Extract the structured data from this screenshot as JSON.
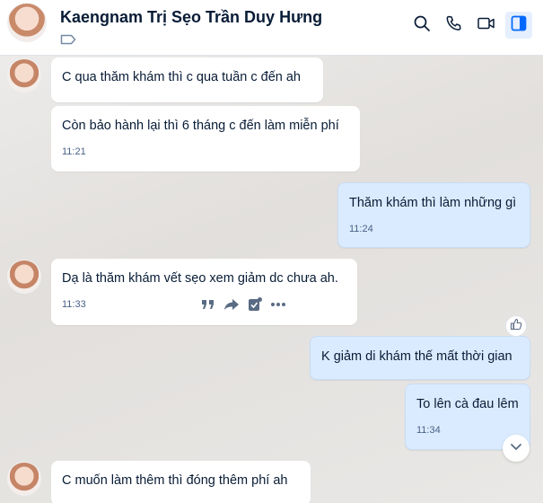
{
  "header": {
    "contact_name": "Kaengnam Trị Sẹo Trần Duy Hưng",
    "icons": [
      "search-icon",
      "phone-icon",
      "video-icon",
      "sidebar-toggle-icon"
    ],
    "tag_icon": "tag-icon",
    "accent": "#0068ff"
  },
  "messages": [
    {
      "direction": "in",
      "text": "C qua thăm khám thì c qua tuần c đến ah",
      "time": ""
    },
    {
      "direction": "in",
      "text": "Còn bảo hành lại thì 6 tháng c đến làm miễn phí",
      "time": "11:21"
    },
    {
      "direction": "out",
      "text": "Thăm khám thì làm những gì",
      "time": "11:24"
    },
    {
      "direction": "in",
      "text": "Dạ là thăm khám vết sẹo xem giảm dc chưa ah.",
      "time": "11:33"
    },
    {
      "direction": "out",
      "text": "K giảm di khám thế mất thời gian",
      "time": ""
    },
    {
      "direction": "out",
      "text": "To lên cà đau lêm",
      "time": "11:34"
    },
    {
      "direction": "in",
      "text": "C muốn làm thêm thì đóng thêm phí ah",
      "time": ""
    }
  ],
  "message_toolbar": {
    "icons": [
      "quote-icon",
      "forward-icon",
      "task-icon",
      "more-icon"
    ]
  },
  "colors": {
    "bubble_in": "#ffffff",
    "bubble_out": "#dbebff",
    "time_text": "#476285"
  }
}
